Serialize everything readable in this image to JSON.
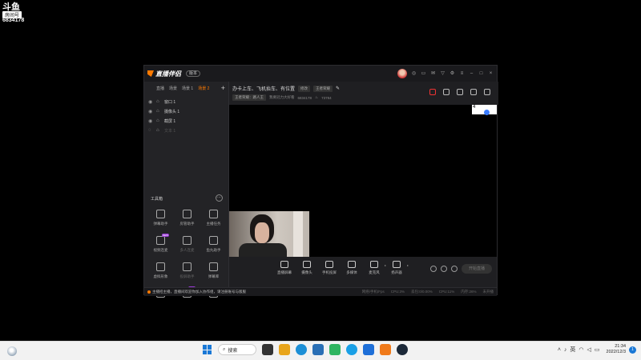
{
  "overlay": {
    "logo": "斗鱼",
    "badge": "房间号",
    "room_id": "6834178"
  },
  "app": {
    "name": "直播伴侣",
    "version_button": "版本",
    "scenes": [
      "直播",
      "场景",
      "场景 1",
      "场景 2"
    ],
    "active_scene_index": 3,
    "sources": [
      {
        "label": "窗口 1",
        "dim": false
      },
      {
        "label": "摄像头 1",
        "dim": false
      },
      {
        "label": "截屏 1",
        "dim": false
      },
      {
        "label": "文本 1",
        "dim": true
      }
    ],
    "tools_title": "工具箱",
    "tools": [
      {
        "label": "弹幕助手",
        "dim": false,
        "new": false
      },
      {
        "label": "房管助手",
        "dim": false,
        "new": false
      },
      {
        "label": "主播任务",
        "dim": false,
        "new": false
      },
      {
        "label": "视频连麦",
        "dim": false,
        "new": true
      },
      {
        "label": "多人连麦",
        "dim": true,
        "new": false
      },
      {
        "label": "鱼丸助手",
        "dim": false,
        "new": false
      },
      {
        "label": "虚拟形象",
        "dim": false,
        "new": false
      },
      {
        "label": "投屏助手",
        "dim": true,
        "new": false
      },
      {
        "label": "弹幕库",
        "dim": false,
        "new": false
      },
      {
        "label": "",
        "dim": false,
        "new": false
      },
      {
        "label": "",
        "dim": false,
        "new": true
      },
      {
        "label": "",
        "dim": false,
        "new": false
      }
    ],
    "room_title": "办卡上车、飞机抬车、有位置",
    "title_tag": "修改",
    "category": "王者荣耀",
    "meta_category": "王者荣耀：路人王",
    "meta_text": "我要冠力大好看",
    "room_number": "6834178",
    "heat": "73784",
    "mini_preview_label": "4",
    "controls": [
      "直播屏幕",
      "摄像头",
      "手机投屏",
      "多媒体",
      "麦克风",
      "扬声器"
    ],
    "start_button": "开始直播",
    "notice": "主播招主播，直播间欢迎你加入协作组，请注册账号与版服",
    "stats": [
      "网络/手机/Fps",
      "CPU:3%",
      "丢包:0/0.00%",
      "CPU:11%",
      "内存:26%",
      "未开播"
    ]
  },
  "taskbar": {
    "search_label": "搜索",
    "tray_lang": "英",
    "time": "21:34",
    "date": "2022/12/3",
    "notifications": "1"
  }
}
